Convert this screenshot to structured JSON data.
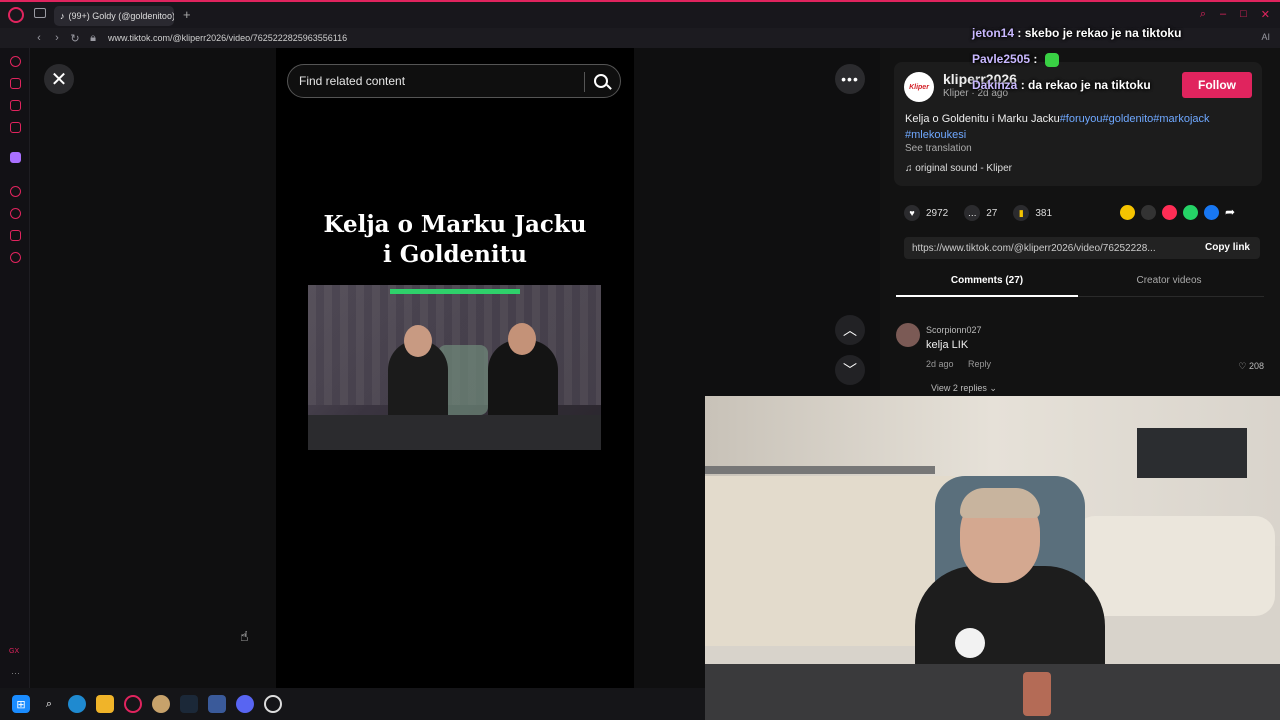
{
  "browser": {
    "tab_title": "(99+) Goldy (@goldenitoo)",
    "url": "www.tiktok.com/@kliperr2026/video/7625222825963556116",
    "addr_right": "AI"
  },
  "video": {
    "search_placeholder": "Find related content",
    "title_line1": "Kelja o Marku Jacku",
    "title_line2": "i Goldenitu"
  },
  "info": {
    "avatar_text": "Kliper",
    "author_name": "kliperr2026",
    "author_sub": "Kliper · 2d ago",
    "follow_label": "Follow",
    "desc_text": "Kelja o Goldenitu i Marku Jacku",
    "desc_tags": "#foruyou#goldenito#markojack #mlekoukesi",
    "see_translation": "See translation",
    "sound": "original sound - Kliper"
  },
  "actions": {
    "likes": "2972",
    "comments": "27",
    "saves": "381",
    "share_colors": [
      "#f5c400",
      "#333333",
      "#ff2d55",
      "#25d366",
      "#1877f2"
    ]
  },
  "link": {
    "url": "https://www.tiktok.com/@kliperr2026/video/76252228...",
    "copy_label": "Copy link"
  },
  "tabs": {
    "comments_label": "Comments (27)",
    "creator_label": "Creator videos"
  },
  "comment": {
    "user": "Scorpionn027",
    "text": "kelja LIK",
    "meta_time": "2d ago",
    "reply": "Reply",
    "likes": "208",
    "view_replies": "View 2 replies"
  },
  "chat": [
    {
      "user": "jeton14",
      "message": "skebo je rekao je na tiktoku"
    },
    {
      "user": "Pavle2505",
      "message": ""
    },
    {
      "user": "Dakinza",
      "message": "da rekao je na tiktoku"
    }
  ],
  "colors": {
    "accent": "#e0245e",
    "tag_link": "#6fa8ff",
    "chat_emote": "#39d144"
  }
}
